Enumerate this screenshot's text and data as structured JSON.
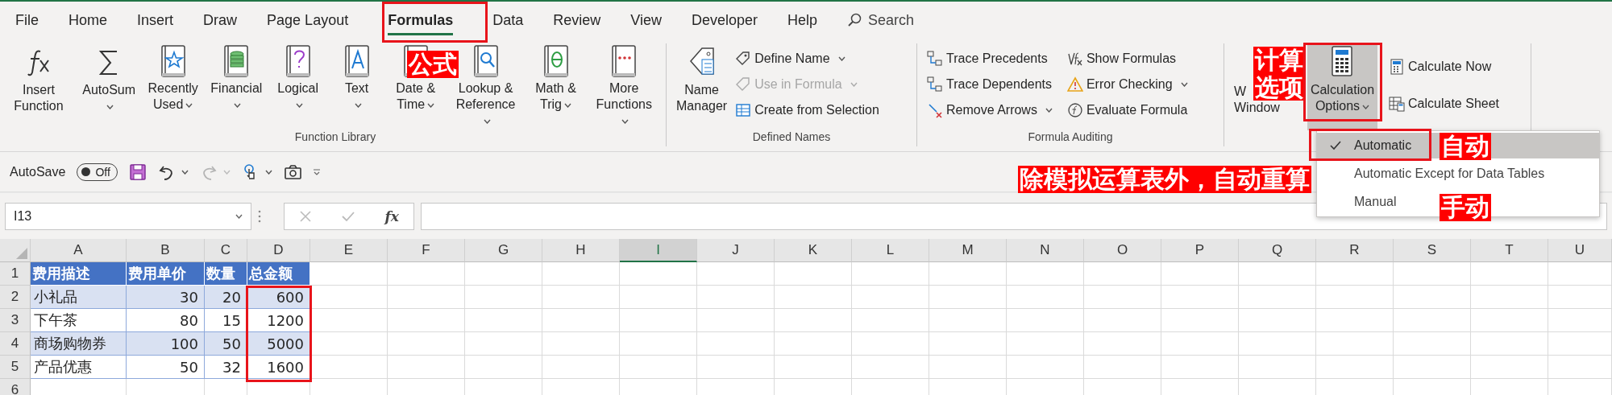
{
  "tabs": [
    {
      "label": "File",
      "selected": false
    },
    {
      "label": "Home",
      "selected": false
    },
    {
      "label": "Insert",
      "selected": false
    },
    {
      "label": "Draw",
      "selected": false
    },
    {
      "label": "Page Layout",
      "selected": false
    },
    {
      "label": "Formulas",
      "selected": true
    },
    {
      "label": "Data",
      "selected": false
    },
    {
      "label": "Review",
      "selected": false
    },
    {
      "label": "View",
      "selected": false
    },
    {
      "label": "Developer",
      "selected": false
    },
    {
      "label": "Help",
      "selected": false
    }
  ],
  "search": {
    "placeholder": "Search"
  },
  "ribbon_groups": [
    {
      "label": "Function Library",
      "large_buttons": [
        {
          "lines": [
            "Insert",
            "Function"
          ],
          "dropdown": false,
          "pressed": false
        },
        {
          "lines": [
            "AutoSum"
          ],
          "dropdown": true,
          "pressed": false
        },
        {
          "lines": [
            "Recently",
            "Used"
          ],
          "dropdown": true,
          "pressed": false
        },
        {
          "lines": [
            "Financial"
          ],
          "dropdown": true,
          "pressed": false
        },
        {
          "lines": [
            "Logical"
          ],
          "dropdown": true,
          "pressed": false
        },
        {
          "lines": [
            "Text"
          ],
          "dropdown": true,
          "pressed": false
        },
        {
          "lines": [
            "Date &",
            "Time"
          ],
          "dropdown": true,
          "pressed": false
        },
        {
          "lines": [
            "Lookup &",
            "Reference"
          ],
          "dropdown": true,
          "pressed": false
        },
        {
          "lines": [
            "Math &",
            "Trig"
          ],
          "dropdown": true,
          "pressed": false
        },
        {
          "lines": [
            "More",
            "Functions"
          ],
          "dropdown": true,
          "pressed": false
        }
      ]
    },
    {
      "label": "Defined Names",
      "large_buttons": [
        {
          "lines": [
            "Name",
            "Manager"
          ],
          "dropdown": false,
          "pressed": false
        }
      ],
      "small_columns": [
        [
          {
            "label": "Define Name",
            "dropdown": true,
            "disabled": false
          },
          {
            "label": "Use in Formula",
            "dropdown": true,
            "disabled": true
          },
          {
            "label": "Create from Selection",
            "dropdown": false,
            "disabled": false
          }
        ]
      ]
    },
    {
      "label": "Formula Auditing",
      "small_columns": [
        [
          {
            "label": "Trace Precedents",
            "dropdown": false,
            "disabled": false
          },
          {
            "label": "Trace Dependents",
            "dropdown": false,
            "disabled": false
          },
          {
            "label": "Remove Arrows",
            "dropdown": true,
            "disabled": false
          }
        ],
        [
          {
            "label": "Show Formulas",
            "dropdown": false,
            "disabled": false
          },
          {
            "label": "Error Checking",
            "dropdown": true,
            "disabled": false
          },
          {
            "label": "Evaluate Formula",
            "dropdown": false,
            "disabled": false
          }
        ]
      ]
    },
    {
      "large_buttons": [
        {
          "lines": [
            "W",
            "Window"
          ],
          "dropdown": false,
          "pressed": false
        },
        {
          "lines": [
            "Calculation",
            "Options"
          ],
          "dropdown": true,
          "pressed": true
        }
      ],
      "small_columns": [
        [
          {
            "label": "Calculate Now",
            "dropdown": false,
            "disabled": false
          },
          {
            "label": "Calculate Sheet",
            "dropdown": false,
            "disabled": false
          }
        ]
      ]
    }
  ],
  "quick_access": {
    "autosave_label": "AutoSave",
    "autosave": {
      "text": "Off",
      "on": false
    },
    "tools": [
      {
        "dropdown": false,
        "disabled": false
      },
      {
        "dropdown": true,
        "disabled": false
      },
      {
        "dropdown": true,
        "disabled": true
      },
      {
        "dropdown": true,
        "disabled": false
      },
      {
        "dropdown": false,
        "disabled": false
      }
    ]
  },
  "formula_bar": {
    "name_box": "I13",
    "fx": "fx"
  },
  "sheet": {
    "columns": [
      {
        "label": "A",
        "selected": false
      },
      {
        "label": "B",
        "selected": false
      },
      {
        "label": "C",
        "selected": false
      },
      {
        "label": "D",
        "selected": false
      },
      {
        "label": "E",
        "selected": false
      },
      {
        "label": "F",
        "selected": false
      },
      {
        "label": "G",
        "selected": false
      },
      {
        "label": "H",
        "selected": false
      },
      {
        "label": "I",
        "selected": true
      },
      {
        "label": "J",
        "selected": false
      },
      {
        "label": "K",
        "selected": false
      },
      {
        "label": "L",
        "selected": false
      },
      {
        "label": "M",
        "selected": false
      },
      {
        "label": "N",
        "selected": false
      },
      {
        "label": "O",
        "selected": false
      },
      {
        "label": "P",
        "selected": false
      },
      {
        "label": "Q",
        "selected": false
      },
      {
        "label": "R",
        "selected": false
      },
      {
        "label": "S",
        "selected": false
      },
      {
        "label": "T",
        "selected": false
      },
      {
        "label": "U",
        "selected": false
      }
    ],
    "rows": [
      {
        "header": "1",
        "kind": "header",
        "cells": [
          "费用描述",
          "费用单价",
          "数量",
          "总金额"
        ]
      },
      {
        "header": "2",
        "kind": "band",
        "cells": [
          "小礼品",
          "30",
          "20",
          "600"
        ]
      },
      {
        "header": "3",
        "kind": "plain",
        "cells": [
          "下午茶",
          "80",
          "15",
          "1200"
        ]
      },
      {
        "header": "4",
        "kind": "band",
        "cells": [
          "商场购物券",
          "100",
          "50",
          "5000"
        ]
      },
      {
        "header": "5",
        "kind": "plain",
        "cells": [
          "产品优惠",
          "50",
          "32",
          "1600"
        ]
      },
      {
        "header": "6",
        "kind": "empty",
        "cells": []
      }
    ]
  },
  "calculation_menu": {
    "items": [
      {
        "label": "Automatic",
        "checked": true,
        "selected": true
      },
      {
        "label": "Automatic Except for Data Tables",
        "checked": false,
        "selected": false
      },
      {
        "label": "Manual",
        "checked": false,
        "selected": false
      }
    ]
  },
  "annotations": [
    {
      "kind": "box"
    },
    {
      "kind": "label",
      "lines": [
        "公式"
      ]
    },
    {
      "kind": "label",
      "lines": [
        "计算",
        "选项"
      ]
    },
    {
      "kind": "box"
    },
    {
      "kind": "box"
    },
    {
      "kind": "label",
      "lines": [
        "自动"
      ]
    },
    {
      "kind": "label",
      "lines": [
        "除模拟运算表外，自动重算"
      ]
    },
    {
      "kind": "label",
      "lines": [
        "手动"
      ]
    },
    {
      "kind": "box"
    }
  ]
}
